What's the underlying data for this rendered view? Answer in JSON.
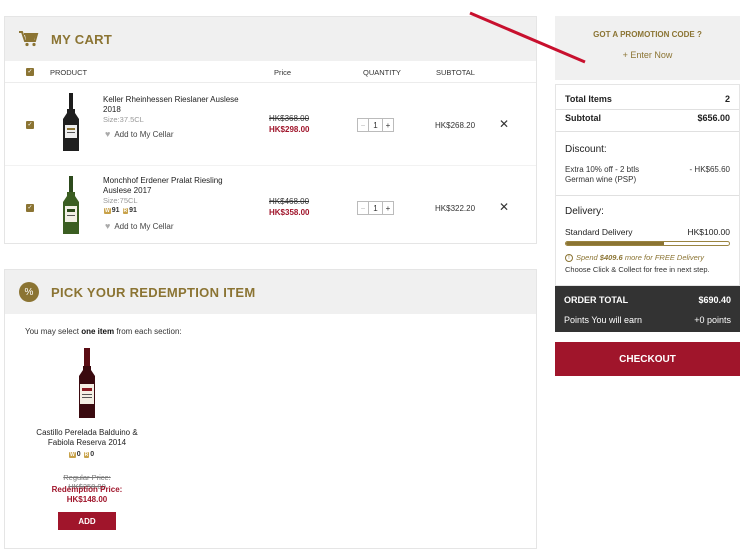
{
  "cart": {
    "title": "MY CART",
    "columns": {
      "product": "PRODUCT",
      "price": "Price",
      "quantity": "QUANTITY",
      "subtotal": "SUBTOTAL"
    },
    "items": [
      {
        "name": "Keller Rheinhessen Rieslaner Auslese 2018",
        "size": "Size:37.5CL",
        "add_to_cellar": "Add to My Cellar",
        "old_price": "HK$368.00",
        "new_price": "HK$298.00",
        "qty": "1",
        "minus": "−",
        "plus": "+",
        "subtotal": "HK$268.20"
      },
      {
        "name": "Monchhof Erdener Pralat Riesling Auslese 2017",
        "size": "Size:75CL",
        "badge1": "91",
        "badge2": "91",
        "add_to_cellar": "Add to My Cellar",
        "old_price": "HK$468.00",
        "new_price": "HK$358.00",
        "qty": "1",
        "minus": "−",
        "plus": "+",
        "subtotal": "HK$322.20"
      }
    ]
  },
  "redemption": {
    "title": "PICK YOUR REDEMPTION ITEM",
    "select_prefix": "You may select ",
    "select_bold": "one item",
    "select_suffix": " from each section:",
    "item": {
      "name": "Castillo Perelada Balduino & Fabiola Reserva 2014",
      "badge1": "0",
      "badge2": "0",
      "regular_price": "Regular Price: HK$258.00",
      "redemption_label": "Redemption Price:",
      "redemption_price": "HK$148.00",
      "add_label": "ADD"
    }
  },
  "promo": {
    "title": "GOT A PROMOTION CODE ?",
    "link": "+ Enter Now"
  },
  "summary": {
    "total_items_label": "Total Items",
    "total_items": "2",
    "subtotal_label": "Subtotal",
    "subtotal": "$656.00",
    "discount_heading": "Discount:",
    "discount_name": "Extra 10% off - 2 btls German wine (PSP)",
    "discount_value": "- HK$65.60",
    "delivery_heading": "Delivery:",
    "delivery_name": "Standard Delivery",
    "delivery_value": "HK$100.00",
    "delivery_progress": 0.6,
    "free_note_prefix": "Spend ",
    "free_note_amount": "$409.6",
    "free_note_suffix": " more for FREE Delivery",
    "collect_note": "Choose Click & Collect for free in next step.",
    "order_total_label": "ORDER TOTAL",
    "order_total": "$690.40",
    "points_label": "Points You will earn",
    "points": "+0 points",
    "checkout_label": "CHECKOUT"
  },
  "colors": {
    "gold": "#8b7433",
    "wine": "#a0152b",
    "dark": "#333333",
    "panel": "#f0f0f0"
  },
  "icons": [
    "cart-icon",
    "percent-icon",
    "heart-icon",
    "close-icon",
    "info-icon"
  ]
}
